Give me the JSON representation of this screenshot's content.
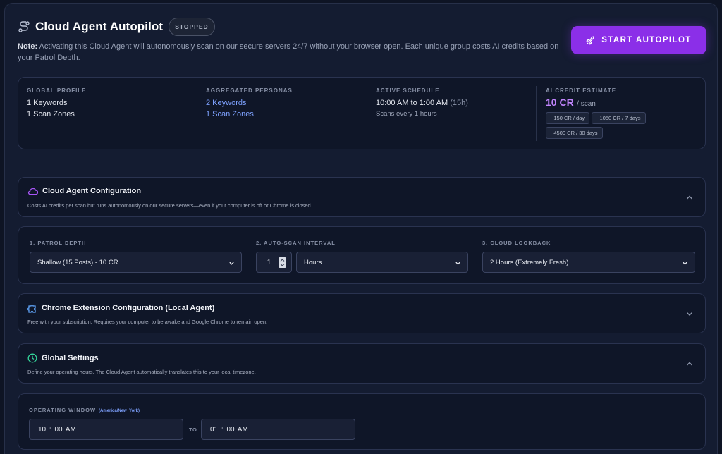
{
  "header": {
    "title": "Cloud Agent Autopilot",
    "status_badge": "STOPPED",
    "note_prefix": "Note:",
    "note_text": " Activating this Cloud Agent will autonomously scan on our secure servers 24/7 without your browser open. Each unique group costs AI credits based on your Patrol Depth.",
    "start_button": "START AUTOPILOT"
  },
  "stats": {
    "global_profile": {
      "label": "GLOBAL PROFILE",
      "line1": "1 Keywords",
      "line2": "1 Scan Zones"
    },
    "aggregated_personas": {
      "label": "AGGREGATED PERSONAS",
      "line1": "2 Keywords",
      "line2": "1 Scan Zones"
    },
    "active_schedule": {
      "label": "ACTIVE SCHEDULE",
      "time": "10:00 AM to 1:00 AM",
      "duration": "(15h)",
      "sub": "Scans every 1 hours"
    },
    "ai_credit": {
      "label": "AI CREDIT ESTIMATE",
      "value": "10 CR",
      "unit": "/ scan",
      "chips": [
        "~150 CR / day",
        "~1050 CR / 7 days",
        "~4500 CR / 30 days"
      ]
    }
  },
  "cloud_config": {
    "title": "Cloud Agent Configuration",
    "desc": "Costs AI credits per scan but runs autonomously on our secure servers—even if your computer is off or Chrome is closed."
  },
  "patrol": {
    "depth_label": "1. PATROL DEPTH",
    "depth_value": "Shallow (15 Posts) - 10 CR",
    "interval_label": "2. AUTO-SCAN INTERVAL",
    "interval_number": "1",
    "interval_unit": "Hours",
    "lookback_label": "3. CLOUD LOOKBACK",
    "lookback_value": "2 Hours (Extremely Fresh)"
  },
  "chrome_config": {
    "title": "Chrome Extension Configuration (Local Agent)",
    "desc": "Free with your subscription. Requires your computer to be awake and Google Chrome to remain open."
  },
  "global_settings": {
    "title": "Global Settings",
    "desc": "Define your operating hours. The Cloud Agent automatically translates this to your local timezone."
  },
  "operating_window": {
    "label": "OPERATING WINDOW",
    "timezone": "(America/New_York)",
    "start": "10 : 00  AM",
    "to": "TO",
    "end": "01 : 00  AM"
  },
  "colors": {
    "accent": "#8b2fe8",
    "credit": "#c084fc",
    "link_blue": "#7ea2ff",
    "cloud_icon": "#a855f7",
    "puzzle_icon": "#60a5fa",
    "clock_icon": "#34d399"
  }
}
